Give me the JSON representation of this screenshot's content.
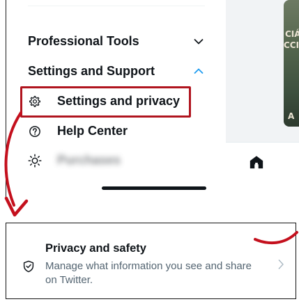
{
  "menu": {
    "sections": [
      {
        "label": "Professional Tools",
        "expanded": false,
        "chevron_icon": "chevron-down-icon"
      },
      {
        "label": "Settings and Support",
        "expanded": true,
        "chevron_icon": "chevron-up-icon"
      }
    ],
    "items": [
      {
        "label": "Settings and privacy",
        "icon": "gear-icon",
        "highlighted": true
      },
      {
        "label": "Help Center",
        "icon": "help-circle-icon"
      },
      {
        "label": "Purchases",
        "icon": "sun-icon",
        "obscured": true
      }
    ]
  },
  "background_app": {
    "bottom_tab_icon": "home-icon",
    "image_text": [
      "CIÁ",
      "CCIÓ",
      "A"
    ]
  },
  "annotation": {
    "highlight_color": "#b0141e",
    "arrow_color": "#c4101d"
  },
  "card": {
    "title": "Privacy and safety",
    "description": "Manage what information you see and share on Twitter.",
    "icon": "shield-icon",
    "chevron_icon": "chevron-right-icon"
  },
  "colors": {
    "primary_text": "#0f1419",
    "secondary_text": "#536471",
    "accent_blue": "#1d9bf0"
  }
}
